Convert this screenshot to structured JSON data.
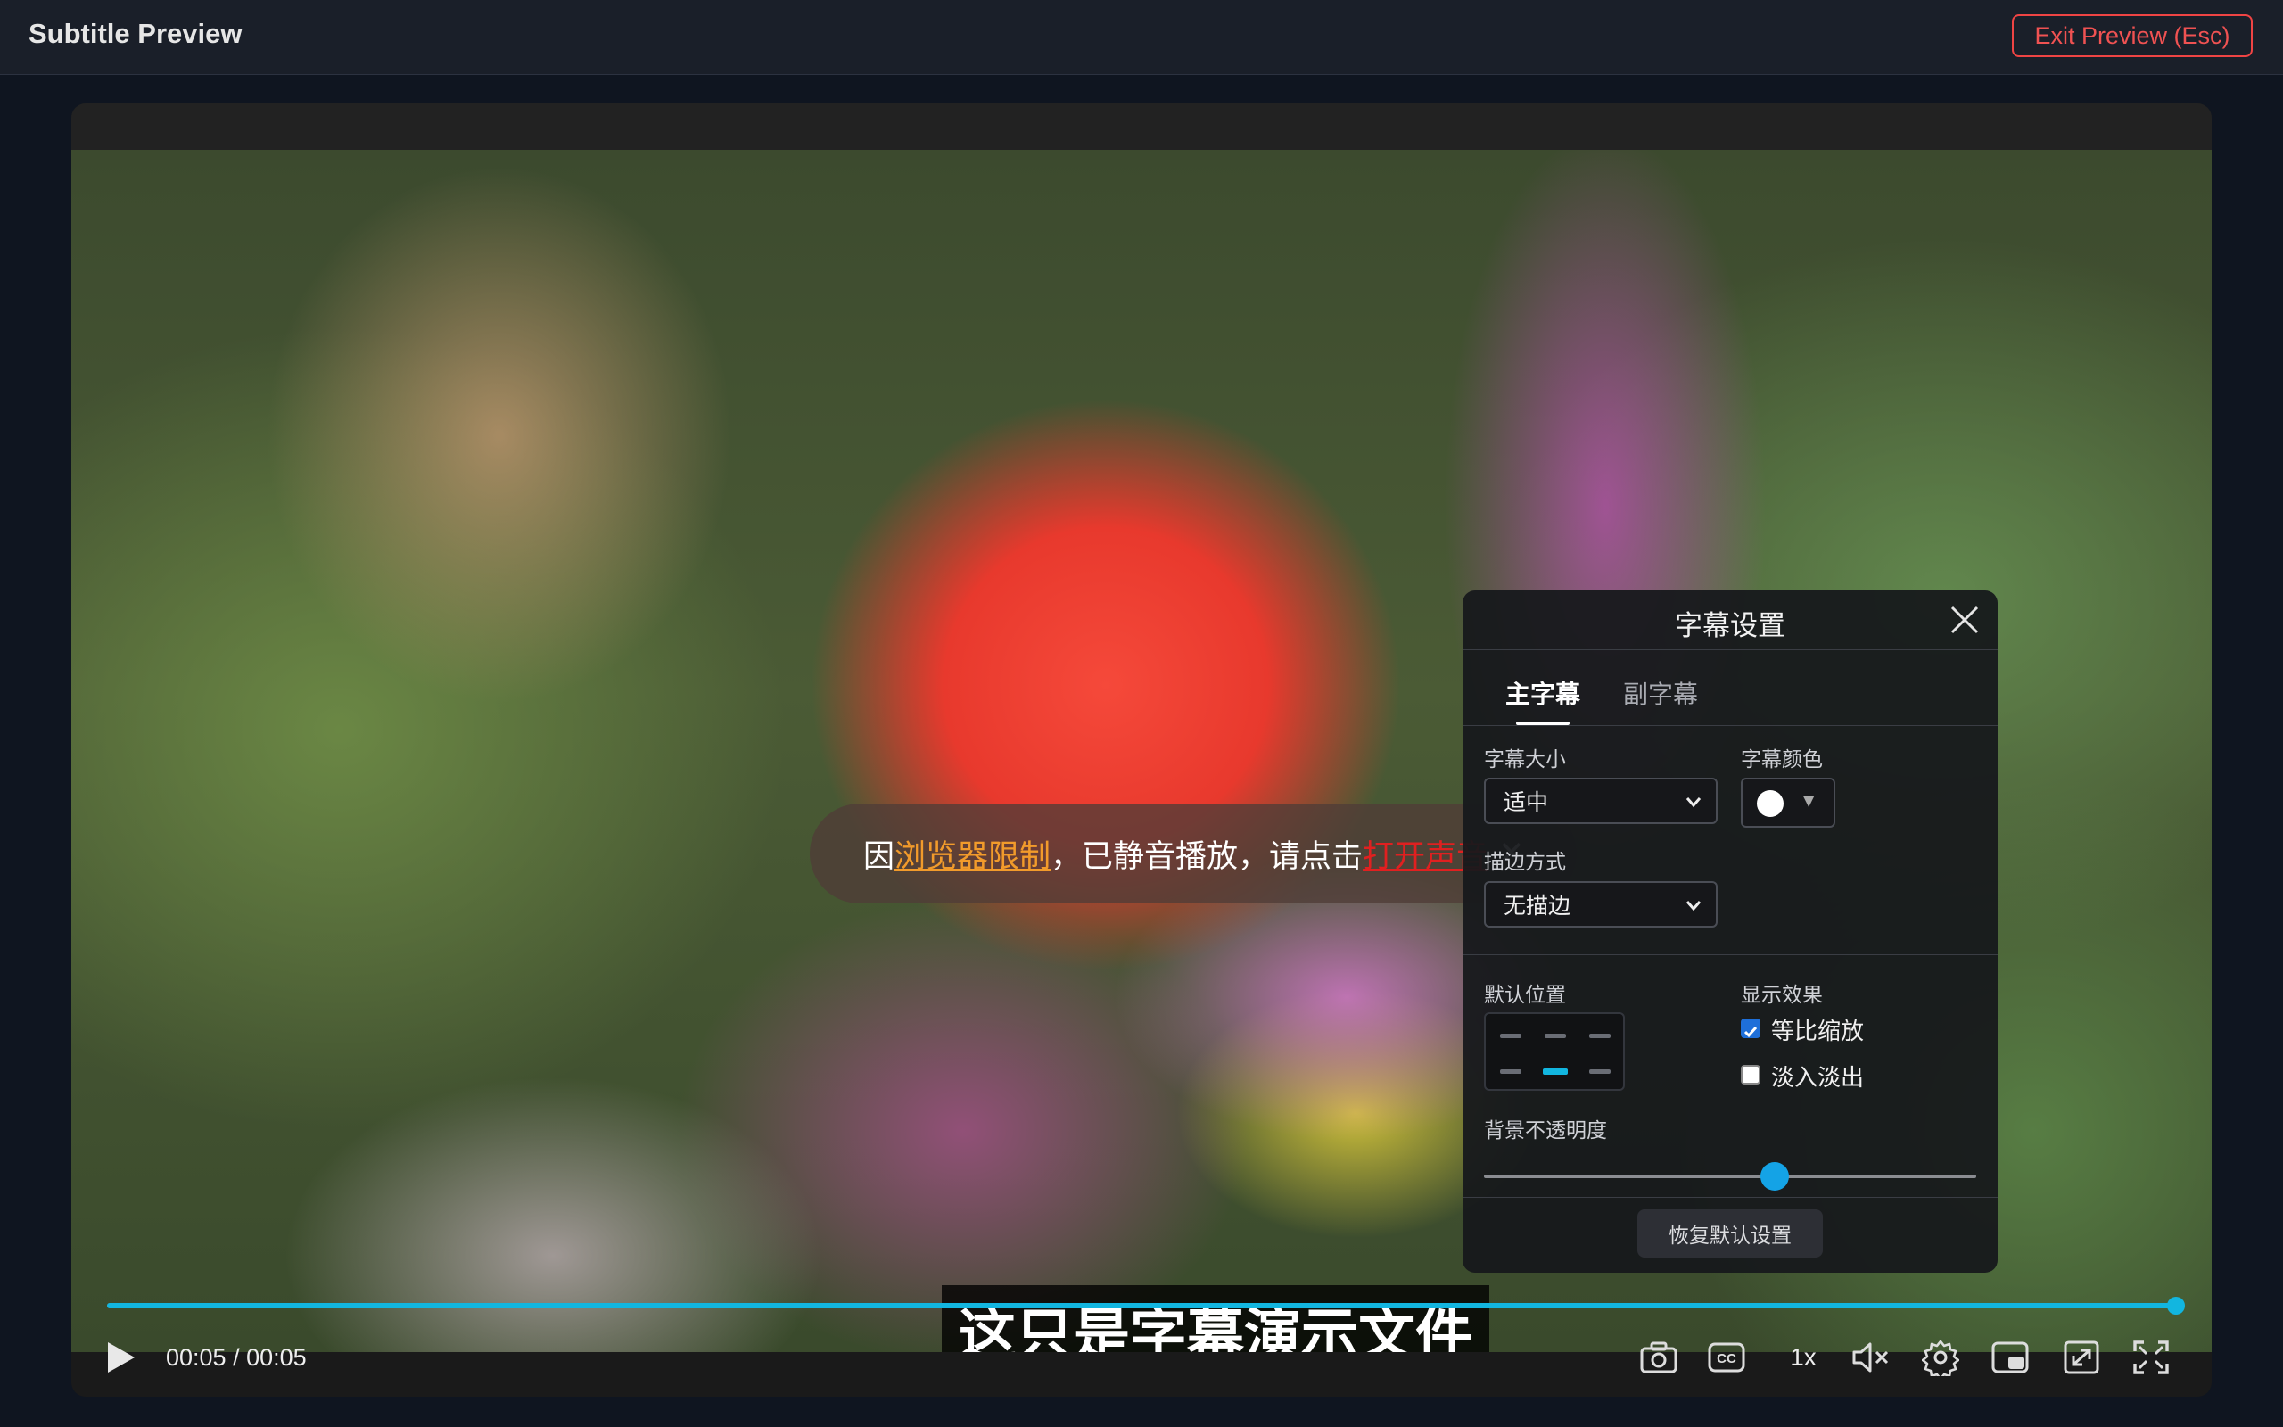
{
  "header": {
    "title": "Subtitle Preview",
    "exit_label": "Exit Preview (Esc)"
  },
  "notice": {
    "prefix": "因 ",
    "link1": "浏览器限制",
    "middle": "，已静音播放，请点击",
    "link2": "打开声音",
    "close": "✕"
  },
  "subtitle": {
    "text": "这只是字幕演示文件"
  },
  "player": {
    "progress": 1.0,
    "time": "00:05 / 00:05",
    "speed": "1x",
    "accent": "#12b6e0"
  },
  "panel": {
    "title": "字幕设置",
    "tabs": [
      {
        "label": "主字幕",
        "active": true
      },
      {
        "label": "副字幕",
        "active": false
      }
    ],
    "size_label": "字幕大小",
    "size_value": "适中",
    "color_label": "字幕颜色",
    "color_value": "#ffffff",
    "outline_label": "描边方式",
    "outline_value": "无描边",
    "position_label": "默认位置",
    "position_selected": "middle-center",
    "effect_label": "显示效果",
    "effects": [
      {
        "label": "等比缩放",
        "checked": true
      },
      {
        "label": "淡入淡出",
        "checked": false
      }
    ],
    "opacity_label": "背景不透明度",
    "opacity_value": 0.59,
    "reset_label": "恢复默认设置"
  },
  "colors": {
    "exit_button": "#ef4444",
    "slider": "#14a3e6",
    "checkbox": "#1e6fd9"
  }
}
